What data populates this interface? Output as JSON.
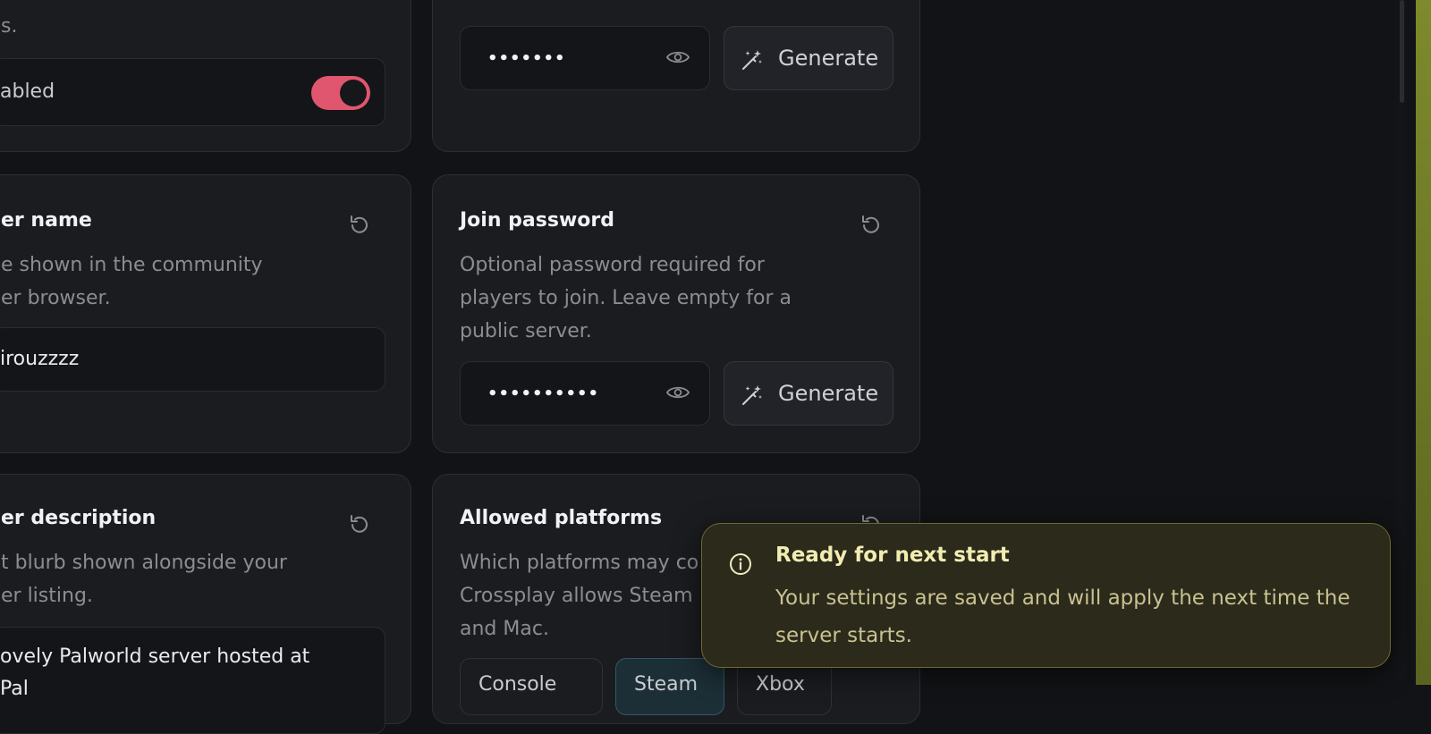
{
  "top_left_card": {
    "desc_fragment": "s.",
    "toggle_label": "abled",
    "toggle_on": true
  },
  "top_right_card": {
    "password_mask": "•••••••",
    "generate_label": "Generate"
  },
  "server_name_card": {
    "title": "er name",
    "desc_lines": [
      "e shown in the community",
      "er browser."
    ],
    "value": "irouzzzz"
  },
  "join_password_card": {
    "title": "Join password",
    "desc_lines": [
      "Optional password required for",
      "players to join. Leave empty for a",
      "public server."
    ],
    "password_mask": "••••••••••",
    "generate_label": "Generate"
  },
  "server_description_card": {
    "title": "er description",
    "desc_lines": [
      "t blurb shown alongside your",
      "er listing."
    ],
    "value_lines": [
      "ovely Palworld server hosted at",
      "  Pal"
    ]
  },
  "allowed_platforms_card": {
    "title": "Allowed platforms",
    "desc_lines": [
      "Which platforms may co",
      "Crossplay allows Steam",
      "and Mac."
    ],
    "platforms": [
      {
        "label": "Console",
        "selected": false
      },
      {
        "label": "Steam",
        "selected": true
      },
      {
        "label": "Xbox",
        "selected": false
      }
    ]
  },
  "toast": {
    "title": "Ready for next start",
    "body": "Your settings are saved and will apply the next time the server starts."
  },
  "colors": {
    "accent_toggle": "#e0566e",
    "toast_bg": "#2b2a1b",
    "toast_title": "#f3ecb2"
  }
}
